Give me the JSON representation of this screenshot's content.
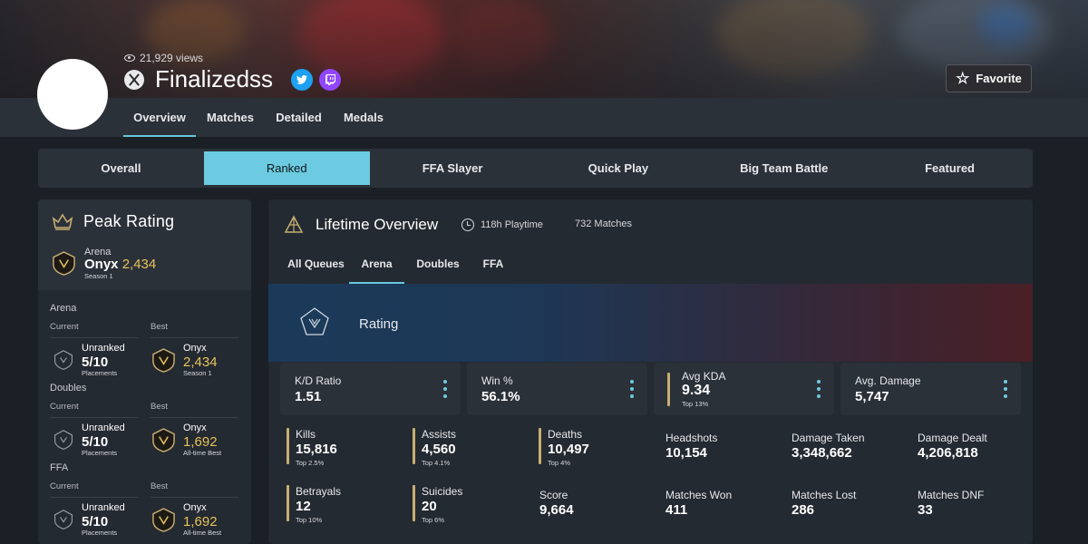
{
  "profile": {
    "views": "21,929 views",
    "name": "Finalizedss",
    "favorite_label": "Favorite",
    "icons": [
      "eye-icon",
      "xbox-icon",
      "twitter-icon",
      "twitch-icon",
      "star-icon"
    ],
    "colors": {
      "accent": "#6ccbe0",
      "gold": "#e6c25a",
      "twitter": "#1da1f2",
      "twitch": "#9146ff"
    }
  },
  "profile_nav": [
    {
      "label": "Overview",
      "active": true
    },
    {
      "label": "Matches",
      "active": false
    },
    {
      "label": "Detailed",
      "active": false
    },
    {
      "label": "Medals",
      "active": false
    }
  ],
  "playlist_tabs": [
    {
      "label": "Overall",
      "active": false
    },
    {
      "label": "Ranked",
      "active": true
    },
    {
      "label": "FFA Slayer",
      "active": false
    },
    {
      "label": "Quick Play",
      "active": false
    },
    {
      "label": "Big Team Battle",
      "active": false
    },
    {
      "label": "Featured",
      "active": false
    }
  ],
  "peak": {
    "title": "Peak Rating",
    "category": "Arena",
    "tier": "Onyx",
    "value": "2,434",
    "season": "Season 1"
  },
  "rank_sections": [
    {
      "title": "Arena",
      "current_label": "Current",
      "best_label": "Best",
      "current": {
        "tier": "Unranked",
        "value": "5/10",
        "sub": "Placements"
      },
      "best": {
        "tier": "Onyx",
        "value": "2,434",
        "sub": "Season 1"
      }
    },
    {
      "title": "Doubles",
      "current_label": "Current",
      "best_label": "Best",
      "current": {
        "tier": "Unranked",
        "value": "5/10",
        "sub": "Placements"
      },
      "best": {
        "tier": "Onyx",
        "value": "1,692",
        "sub": "All-time Best"
      }
    },
    {
      "title": "FFA",
      "current_label": "Current",
      "best_label": "Best",
      "current": {
        "tier": "Unranked",
        "value": "5/10",
        "sub": "Placements"
      },
      "best": {
        "tier": "Onyx",
        "value": "1,692",
        "sub": "All-time Best"
      }
    }
  ],
  "lifetime": {
    "title": "Lifetime Overview",
    "playtime": "118h Playtime",
    "matches": "732 Matches",
    "queue_tabs": [
      {
        "label": "All Queues",
        "active": false
      },
      {
        "label": "Arena",
        "active": true
      },
      {
        "label": "Doubles",
        "active": false
      },
      {
        "label": "FFA",
        "active": false
      }
    ],
    "rating_label": "Rating",
    "cards": [
      {
        "label": "K/D Ratio",
        "value": "1.51"
      },
      {
        "label": "Win %",
        "value": "56.1%"
      },
      {
        "label": "Avg KDA",
        "value": "9.34",
        "rank": "Top 13%"
      },
      {
        "label": "Avg. Damage",
        "value": "5,747"
      }
    ],
    "stats": [
      {
        "label": "Kills",
        "value": "15,816",
        "rank": "Top 2.5%"
      },
      {
        "label": "Assists",
        "value": "4,560",
        "rank": "Top 4.1%"
      },
      {
        "label": "Deaths",
        "value": "10,497",
        "rank": "Top 4%"
      },
      {
        "label": "Headshots",
        "value": "10,154"
      },
      {
        "label": "Damage Taken",
        "value": "3,348,662"
      },
      {
        "label": "Damage Dealt",
        "value": "4,206,818"
      },
      {
        "label": "Betrayals",
        "value": "12",
        "rank": "Top 10%"
      },
      {
        "label": "Suicides",
        "value": "20",
        "rank": "Top 6%"
      },
      {
        "label": "Score",
        "value": "9,664"
      },
      {
        "label": "Matches Won",
        "value": "411"
      },
      {
        "label": "Matches Lost",
        "value": "286"
      },
      {
        "label": "Matches DNF",
        "value": "33"
      }
    ]
  }
}
